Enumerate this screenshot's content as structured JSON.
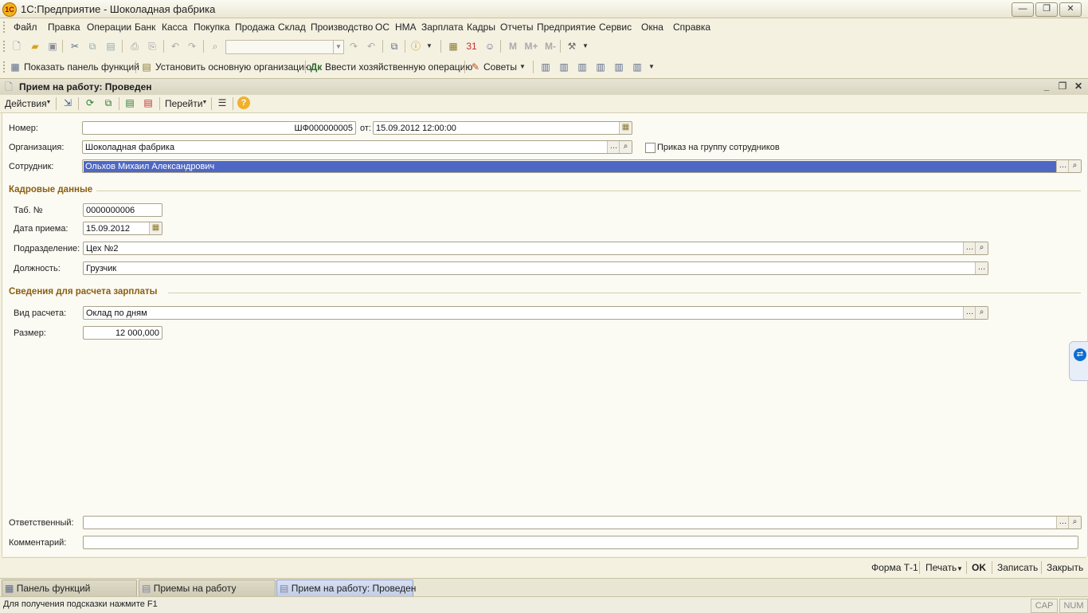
{
  "window": {
    "title": "1С:Предприятие - Шоколадная фабрика",
    "logo_text": "1С",
    "minimize": "—",
    "restore": "❐",
    "close": "✕"
  },
  "menu": [
    "Файл",
    "Правка",
    "Операции",
    "Банк",
    "Касса",
    "Покупка",
    "Продажа",
    "Склад",
    "Производство",
    "ОС",
    "НМА",
    "Зарплата",
    "Кадры",
    "Отчеты",
    "Предприятие",
    "Сервис",
    "Окна",
    "Справка"
  ],
  "toolbar2": {
    "show_panel": "Показать панель функций",
    "set_org": "Установить основную организацию",
    "enter_op": "Ввести хозяйственную операцию",
    "tips": "Советы"
  },
  "document": {
    "title": "Прием на работу: Проведен",
    "minimize": "_",
    "restore": "❐",
    "close": "✕"
  },
  "actions": {
    "actions_label": "Действия",
    "goto_label": "Перейти"
  },
  "form": {
    "number_label": "Номер:",
    "number_value": "ШФ000000005",
    "date_from_label": "от:",
    "date_value": "15.09.2012 12:00:00",
    "org_label": "Организация:",
    "org_value": "Шоколадная фабрика",
    "group_order_label": "Приказ на группу сотрудников",
    "employee_label": "Сотрудник:",
    "employee_value": "Ольхов Михаил Александрович",
    "hr_section": "Кадровые данные",
    "tab_no_label": "Таб. №",
    "tab_no_value": "0000000006",
    "hire_date_label": "Дата приема:",
    "hire_date_value": "15.09.2012",
    "department_label": "Подразделение:",
    "department_value": "Цех №2",
    "position_label": "Должность:",
    "position_value": "Грузчик",
    "salary_section": "Сведения для расчета зарплаты",
    "calc_type_label": "Вид расчета:",
    "calc_type_value": "Оклад по дням",
    "amount_label": "Размер:",
    "amount_value": "12 000,000",
    "responsible_label": "Ответственный:",
    "responsible_value": "",
    "comment_label": "Комментарий:",
    "comment_value": ""
  },
  "bottom": {
    "form_t1": "Форма Т-1",
    "print": "Печать",
    "ok": "OK",
    "save": "Записать",
    "close": "Закрыть"
  },
  "taskbar": [
    "Панель функций",
    "Приемы на работу",
    "Прием на работу: Проведен"
  ],
  "status": {
    "hint": "Для получения подсказки нажмите F1",
    "cap": "CAP",
    "num": "NUM"
  }
}
